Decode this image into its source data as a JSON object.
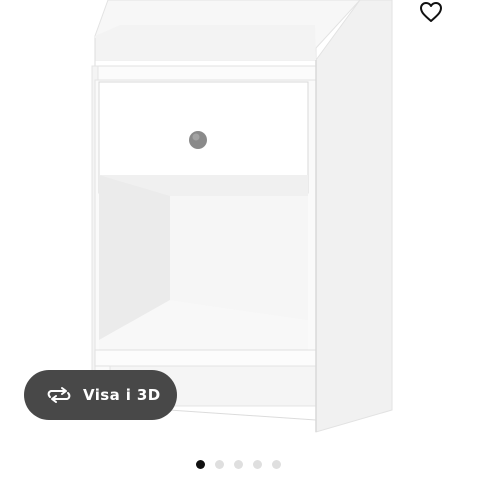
{
  "product": {
    "image_description_icon": "bedside-table-image"
  },
  "favorite": {
    "icon": "heart-outline-icon"
  },
  "view3d": {
    "label": "Visa i 3D",
    "icon": "rotate-arrows-icon"
  },
  "carousel": {
    "total_images": 5,
    "active_index": 0
  },
  "colors": {
    "button_bg": "#484848",
    "dot_active": "#111111",
    "dot_inactive": "#dfdfdf",
    "knob": "#8a8a8a"
  }
}
